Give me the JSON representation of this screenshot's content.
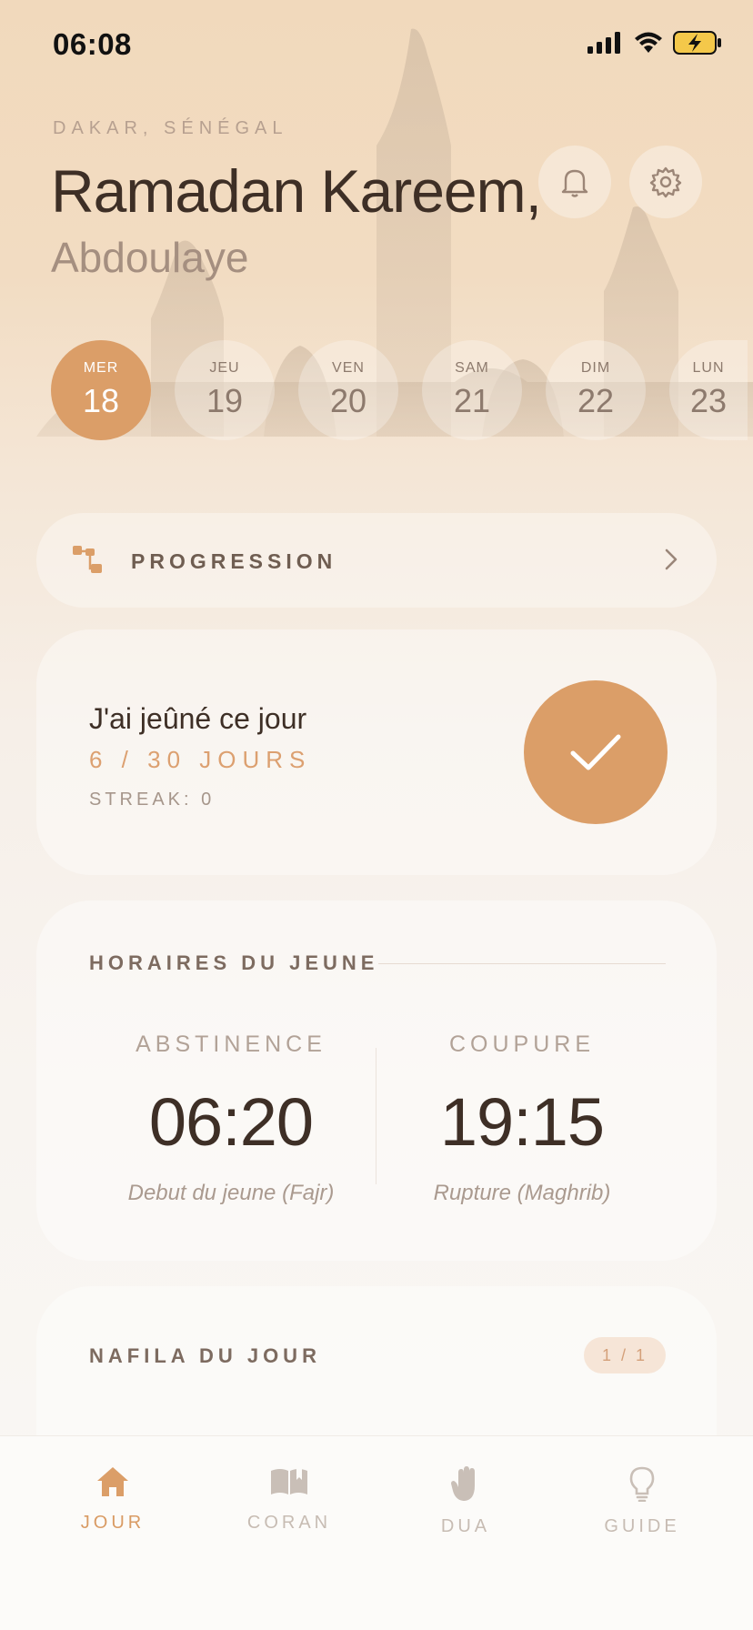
{
  "status_bar": {
    "time": "06:08"
  },
  "header": {
    "location": "DAKAR, SÉNÉGAL",
    "greeting": "Ramadan Kareem,",
    "username": "Abdoulaye"
  },
  "days": [
    {
      "dow": "MER",
      "num": "18",
      "active": true
    },
    {
      "dow": "JEU",
      "num": "19",
      "active": false
    },
    {
      "dow": "VEN",
      "num": "20",
      "active": false
    },
    {
      "dow": "SAM",
      "num": "21",
      "active": false
    },
    {
      "dow": "DIM",
      "num": "22",
      "active": false
    },
    {
      "dow": "LUN",
      "num": "23",
      "active": false
    }
  ],
  "progression": {
    "label": "PROGRESSION"
  },
  "fasting": {
    "title": "J'ai jeûné ce jour",
    "count": "6 / 30 JOURS",
    "streak": "STREAK: 0"
  },
  "schedule": {
    "title": "HORAIRES DU JEUNE",
    "start": {
      "label": "ABSTINENCE",
      "time": "06:20",
      "sub": "Debut du jeune (Fajr)"
    },
    "end": {
      "label": "COUPURE",
      "time": "19:15",
      "sub": "Rupture (Maghrib)"
    }
  },
  "nafila": {
    "title": "NAFILA DU JOUR",
    "badge": "1 / 1"
  },
  "tabs": [
    {
      "label": "JOUR",
      "icon": "home-icon",
      "active": true
    },
    {
      "label": "CORAN",
      "icon": "book-icon",
      "active": false
    },
    {
      "label": "DUA",
      "icon": "hand-icon",
      "active": false
    },
    {
      "label": "GUIDE",
      "icon": "lightbulb-icon",
      "active": false
    }
  ],
  "colors": {
    "accent": "#db9e68",
    "text_dark": "#3e2f26",
    "text_muted": "#a58f80"
  }
}
